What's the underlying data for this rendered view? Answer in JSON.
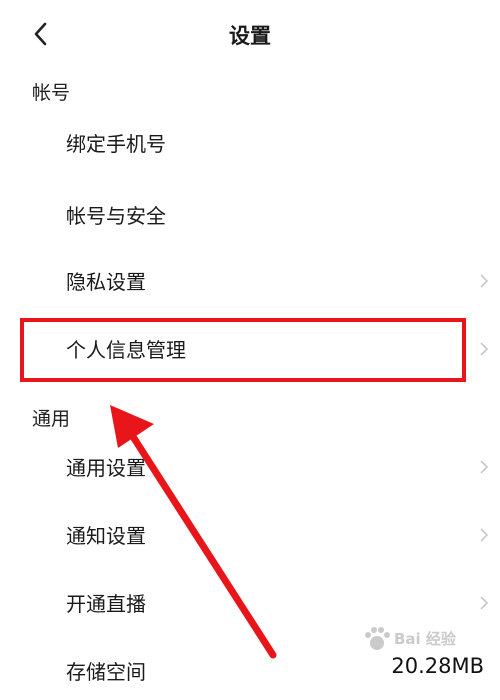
{
  "header": {
    "title": "设置"
  },
  "sections": {
    "account": {
      "label": "帐号"
    },
    "general": {
      "label": "通用"
    }
  },
  "items": {
    "bind_phone": "绑定手机号",
    "account_security": "帐号与安全",
    "privacy": "隐私设置",
    "personal_info": "个人信息管理",
    "general_settings": "通用设置",
    "notification": "通知设置",
    "live": "开通直播",
    "storage": {
      "label": "存储空间",
      "value": "20.28MB"
    }
  },
  "watermark": {
    "text": "Bai 经验"
  },
  "colors": {
    "annotation": "#e8161a",
    "chevron": "#c8c8c8"
  }
}
